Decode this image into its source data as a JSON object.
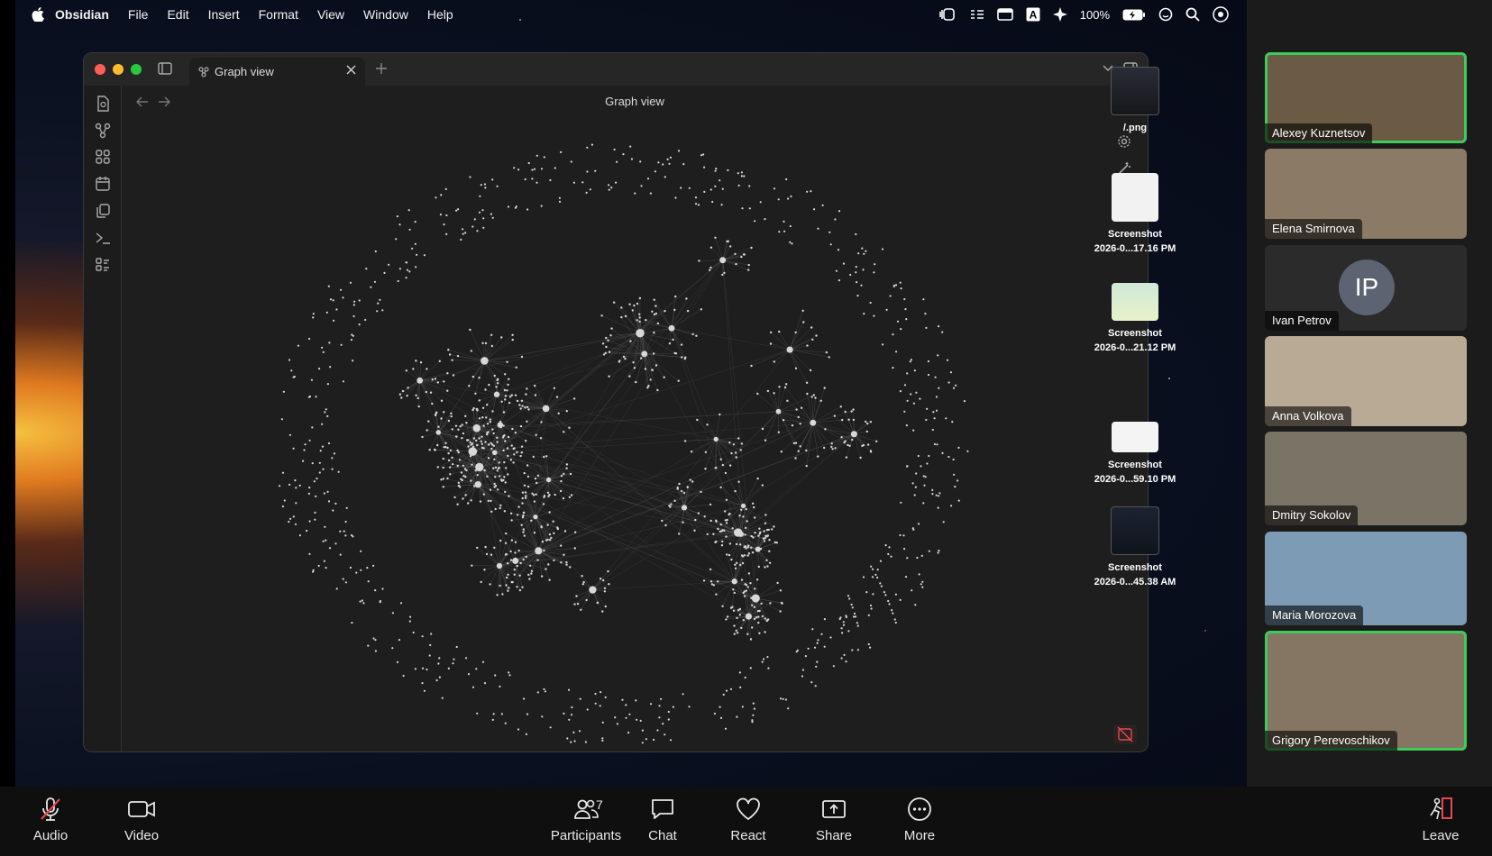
{
  "menubar": {
    "app_name": "Obsidian",
    "items": [
      "File",
      "Edit",
      "Insert",
      "Format",
      "View",
      "Window",
      "Help"
    ],
    "battery": "100%"
  },
  "obsidian": {
    "tab_title": "Graph view",
    "view_title": "Graph view",
    "sidebar_icons": [
      "file-icon",
      "graph-icon",
      "grid-icon",
      "calendar-icon",
      "copy-icon",
      "terminal-icon",
      "list-icon"
    ]
  },
  "desktop_files": [
    {
      "line1": "/.png",
      "line2": ""
    },
    {
      "line1": "Screenshot",
      "line2": "2026-0...17.16 PM"
    },
    {
      "line1": "Screenshot",
      "line2": "2026-0...21.12 PM"
    },
    {
      "line1": "Screenshot",
      "line2": "2026-0...59.10 PM"
    },
    {
      "line1": "Screenshot",
      "line2": "2026-0...45.38 AM"
    }
  ],
  "participants": [
    {
      "name": "Alexey Kuznetsov",
      "speaking": true,
      "bg": "#6b5a44"
    },
    {
      "name": "Elena Smirnova",
      "speaking": false,
      "bg": "#8a7a66"
    },
    {
      "name": "Ivan Petrov",
      "speaking": false,
      "initials": "IP",
      "bg": "#2b2b2b"
    },
    {
      "name": "Anna Volkova",
      "speaking": false,
      "bg": "#b9aa96"
    },
    {
      "name": "Dmitry Sokolov",
      "speaking": false,
      "bg": "#7a7466"
    },
    {
      "name": "Maria Morozova",
      "speaking": false,
      "bg": "#7d9bb5"
    },
    {
      "name": "Grigory Perevoschikov",
      "speaking": true,
      "bg": "#857563"
    }
  ],
  "toolbar": {
    "audio": "Audio",
    "video": "Video",
    "participants": "Participants",
    "participants_count": "7",
    "chat": "Chat",
    "react": "React",
    "share": "Share",
    "more": "More",
    "leave": "Leave"
  },
  "colors": {
    "speaking_outline": "#3ecb5a",
    "graph_node": "#d8d8d8",
    "graph_edge": "#5a5a5a",
    "muted_red": "#e5484d"
  }
}
